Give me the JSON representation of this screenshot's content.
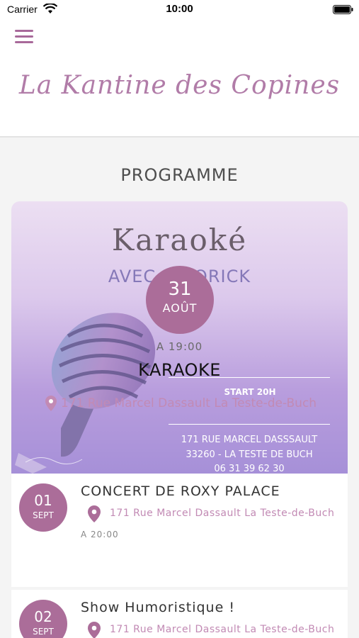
{
  "status_bar": {
    "carrier": "Carrier",
    "time": "10:00"
  },
  "header": {
    "brand": "La Kantine des Copines"
  },
  "section": {
    "title": "PROGRAMME"
  },
  "featured": {
    "poster_title": "Karaoké",
    "poster_subtitle": "AVEC PATORICK",
    "day": "31",
    "month": "AOÛT",
    "time": "A 19:00",
    "name": "KARAOKE",
    "poster_start": "START 20H",
    "location": "171 Rue Marcel Dassault La Teste-de-Buch",
    "poster_address_line1": "171 RUE MARCEL DASSSAULT",
    "poster_address_line2": "33260 - LA TESTE DE BUCH",
    "poster_phone": "06 31 39 62 30"
  },
  "events": [
    {
      "day": "01",
      "month": "SEPT",
      "title": "CONCERT DE ROXY PALACE",
      "location": "171 Rue Marcel Dassault La Teste-de-Buch",
      "time": "A 20:00"
    },
    {
      "day": "02",
      "month": "SEPT",
      "title": "Show Humoristique !",
      "location": "171 Rue Marcel Dassault La Teste-de-Buch",
      "time": ""
    }
  ],
  "colors": {
    "accent": "#ab6d99",
    "brand": "#b17ca8",
    "location_text": "#c28ab4"
  },
  "icons": {
    "menu": "hamburger-menu-icon",
    "location": "map-pin-icon",
    "wifi": "wifi-icon",
    "battery": "battery-icon"
  }
}
